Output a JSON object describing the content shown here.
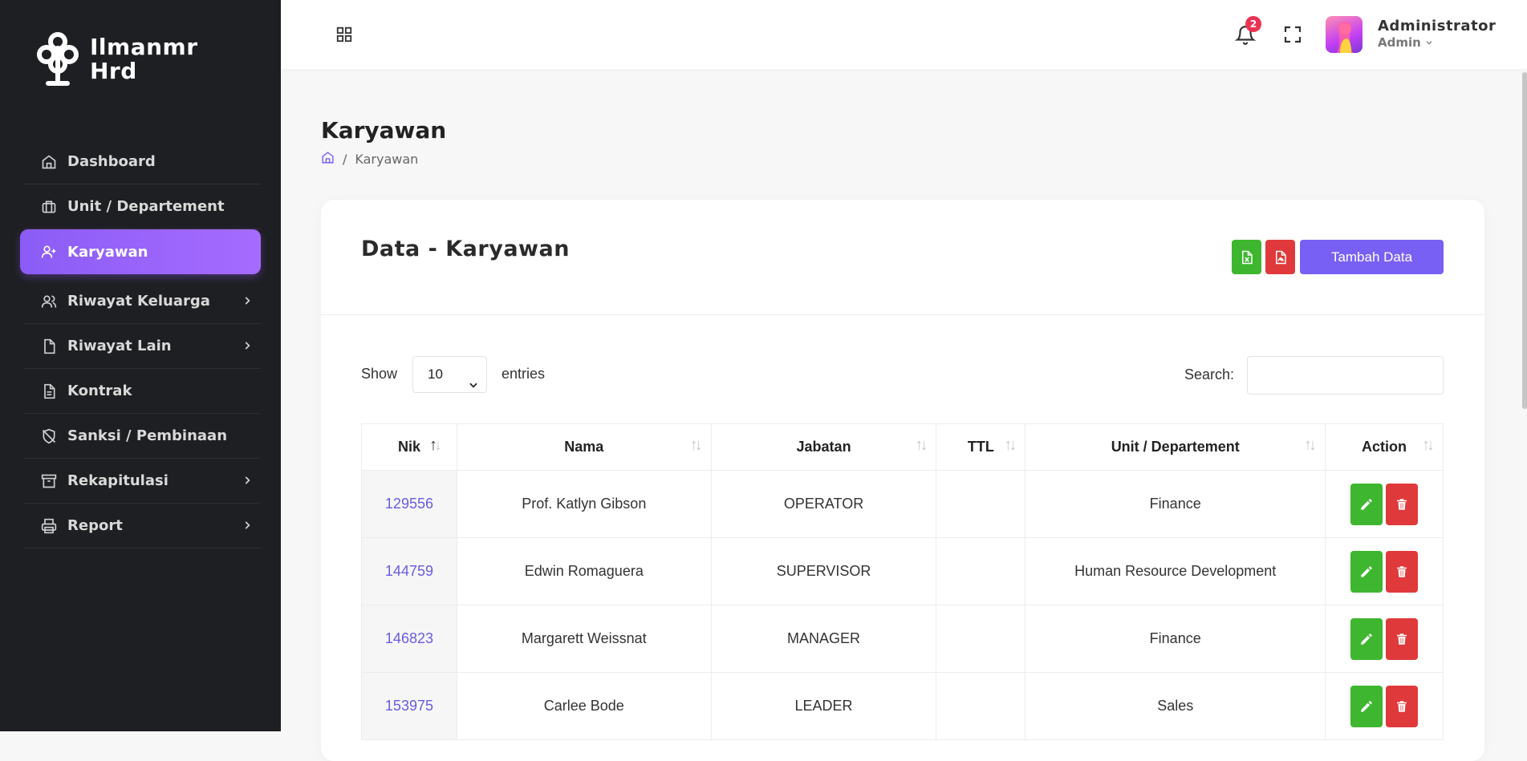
{
  "brand": {
    "name": "Ilmanmr Hrd"
  },
  "sidebar": {
    "items": [
      {
        "label": "Dashboard",
        "icon": "home-icon",
        "has_children": false,
        "active": false
      },
      {
        "label": "Unit / Departement",
        "icon": "briefcase-icon",
        "has_children": false,
        "active": false
      },
      {
        "label": "Karyawan",
        "icon": "user-plus-icon",
        "has_children": false,
        "active": true
      },
      {
        "label": "Riwayat Keluarga",
        "icon": "users-icon",
        "has_children": true,
        "active": false
      },
      {
        "label": "Riwayat Lain",
        "icon": "file-icon",
        "has_children": true,
        "active": false
      },
      {
        "label": "Kontrak",
        "icon": "file-text-icon",
        "has_children": false,
        "active": false
      },
      {
        "label": "Sanksi / Pembinaan",
        "icon": "shield-off-icon",
        "has_children": false,
        "active": false
      },
      {
        "label": "Rekapitulasi",
        "icon": "archive-icon",
        "has_children": true,
        "active": false
      },
      {
        "label": "Report",
        "icon": "printer-icon",
        "has_children": true,
        "active": false
      }
    ]
  },
  "topbar": {
    "notification_count": "2",
    "user_name": "Administrator",
    "user_role": "Admin"
  },
  "page": {
    "title": "Karyawan",
    "breadcrumb_sep": "/",
    "breadcrumb_current": "Karyawan"
  },
  "card": {
    "title": "Data - Karyawan",
    "add_label": "Tambah Data"
  },
  "table_controls": {
    "show_label": "Show",
    "page_size": "10",
    "entries_label": "entries",
    "search_label": "Search:",
    "search_value": ""
  },
  "table": {
    "headers": [
      "Nik",
      "Nama",
      "Jabatan",
      "TTL",
      "Unit / Departement",
      "Action"
    ],
    "rows": [
      {
        "nik": "129556",
        "nama": "Prof. Katlyn Gibson",
        "jabatan": "OPERATOR",
        "ttl": "",
        "unit": "Finance"
      },
      {
        "nik": "144759",
        "nama": "Edwin Romaguera",
        "jabatan": "SUPERVISOR",
        "ttl": "",
        "unit": "Human Resource Development"
      },
      {
        "nik": "146823",
        "nama": "Margarett Weissnat",
        "jabatan": "MANAGER",
        "ttl": "",
        "unit": "Finance"
      },
      {
        "nik": "153975",
        "nama": "Carlee Bode",
        "jabatan": "LEADER",
        "ttl": "",
        "unit": "Sales"
      }
    ]
  },
  "colors": {
    "sidebar_bg": "#1e1f22",
    "accent": "#7860f4",
    "success": "#3fb62f",
    "danger": "#e0393b"
  }
}
